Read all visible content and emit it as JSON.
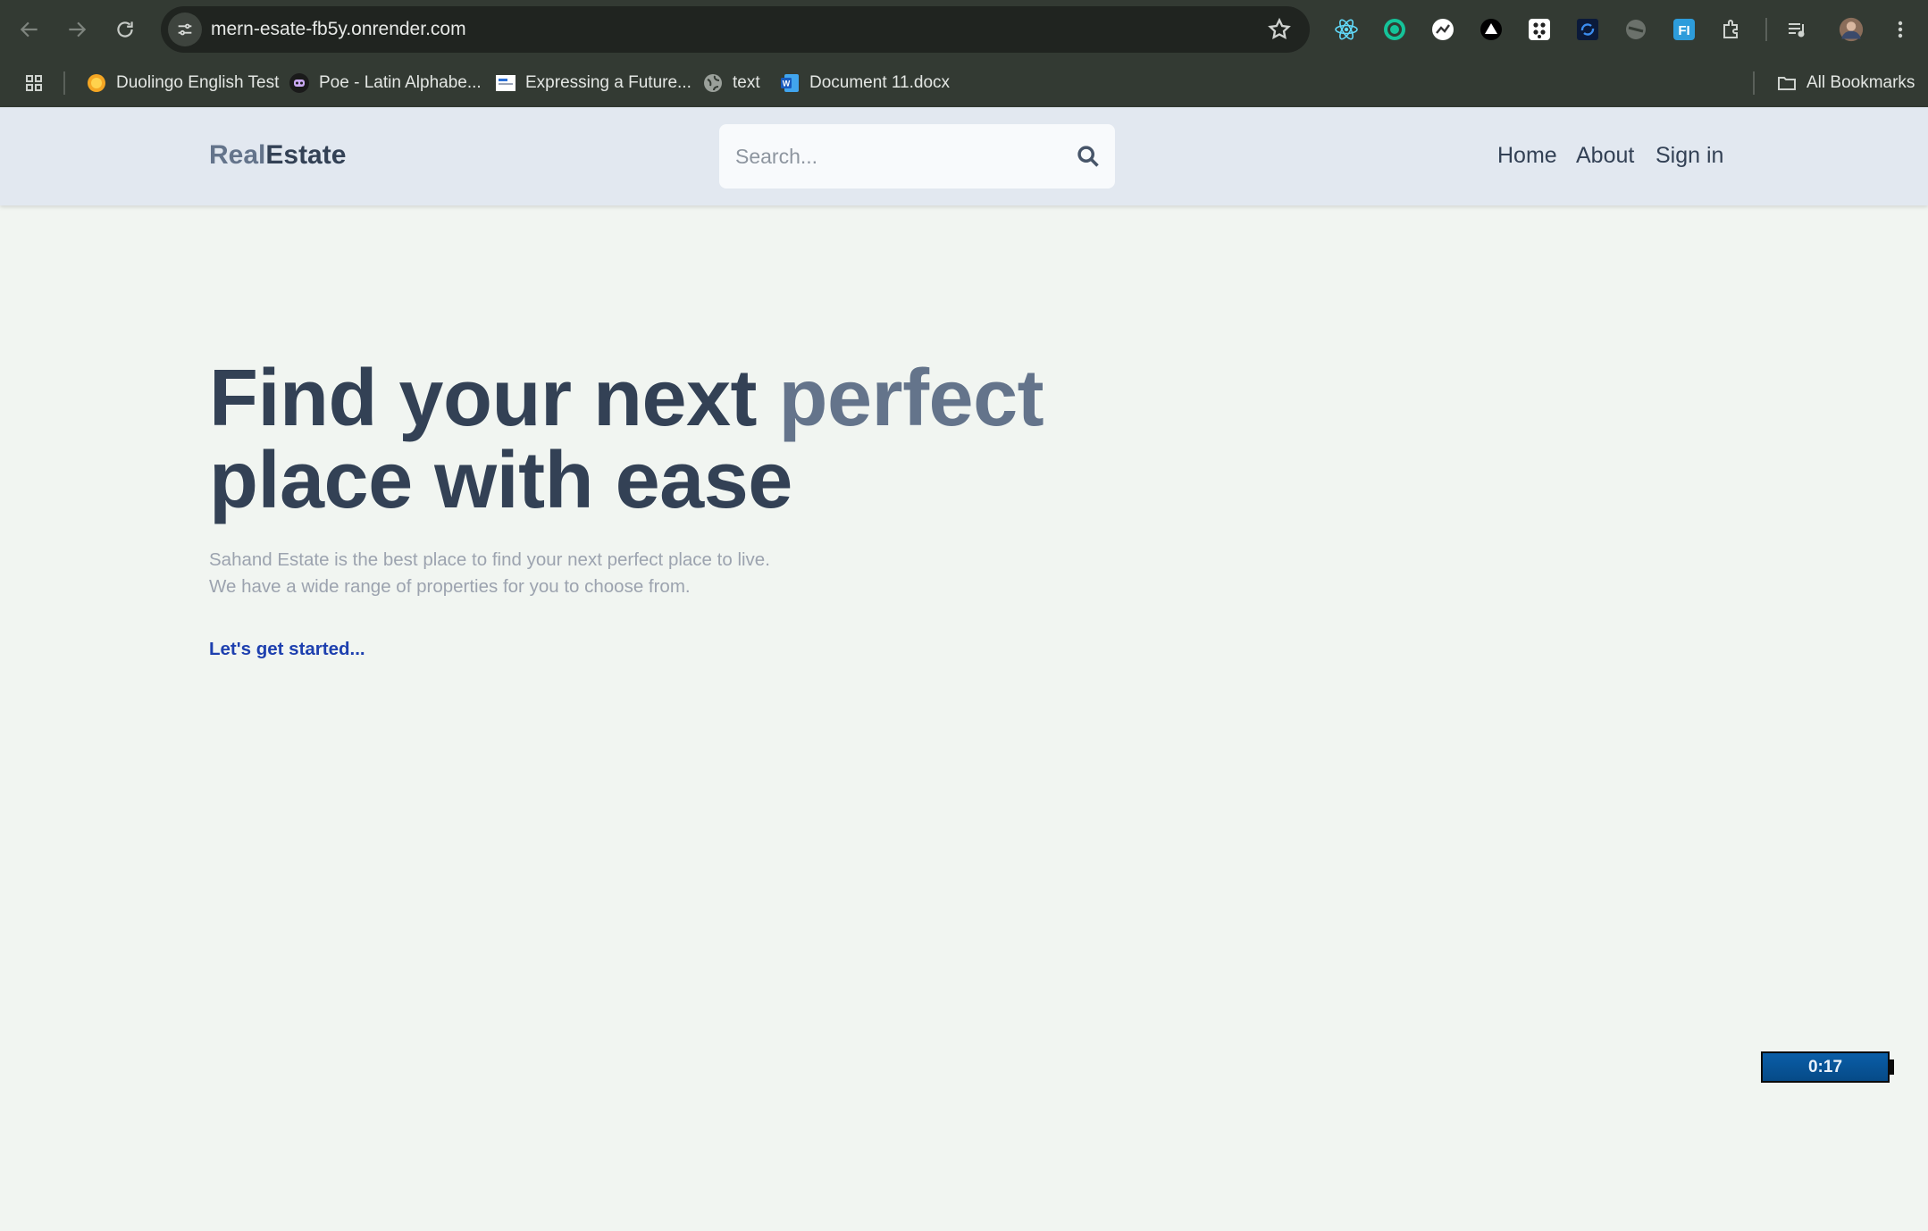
{
  "browser": {
    "url": "mern-esate-fb5y.onrender.com",
    "bookmarks": [
      {
        "label": "Duolingo English Test"
      },
      {
        "label": "Poe - Latin Alphabe..."
      },
      {
        "label": "Expressing a Future..."
      },
      {
        "label": "text"
      },
      {
        "label": "Document 11.docx"
      }
    ],
    "all_bookmarks_label": "All Bookmarks"
  },
  "header": {
    "logo_part1": "Real",
    "logo_part2": "Estate",
    "search_placeholder": "Search...",
    "nav": [
      "Home",
      "About",
      "Sign in"
    ]
  },
  "hero": {
    "title_part1": "Find your next ",
    "title_highlight": "perfect",
    "title_part2": "place with ease",
    "subtitle_line1": "Sahand Estate is the best place to find your next perfect place to live.",
    "subtitle_line2": "We have a wide range of properties for you to choose from.",
    "cta": "Let's get started..."
  },
  "overlay": {
    "timer": "0:17"
  },
  "colors": {
    "header_bg": "#e2e8f0",
    "page_bg": "#f1f5f1",
    "title": "#334155",
    "title_highlight": "#64748b",
    "cta": "#1e40af"
  }
}
